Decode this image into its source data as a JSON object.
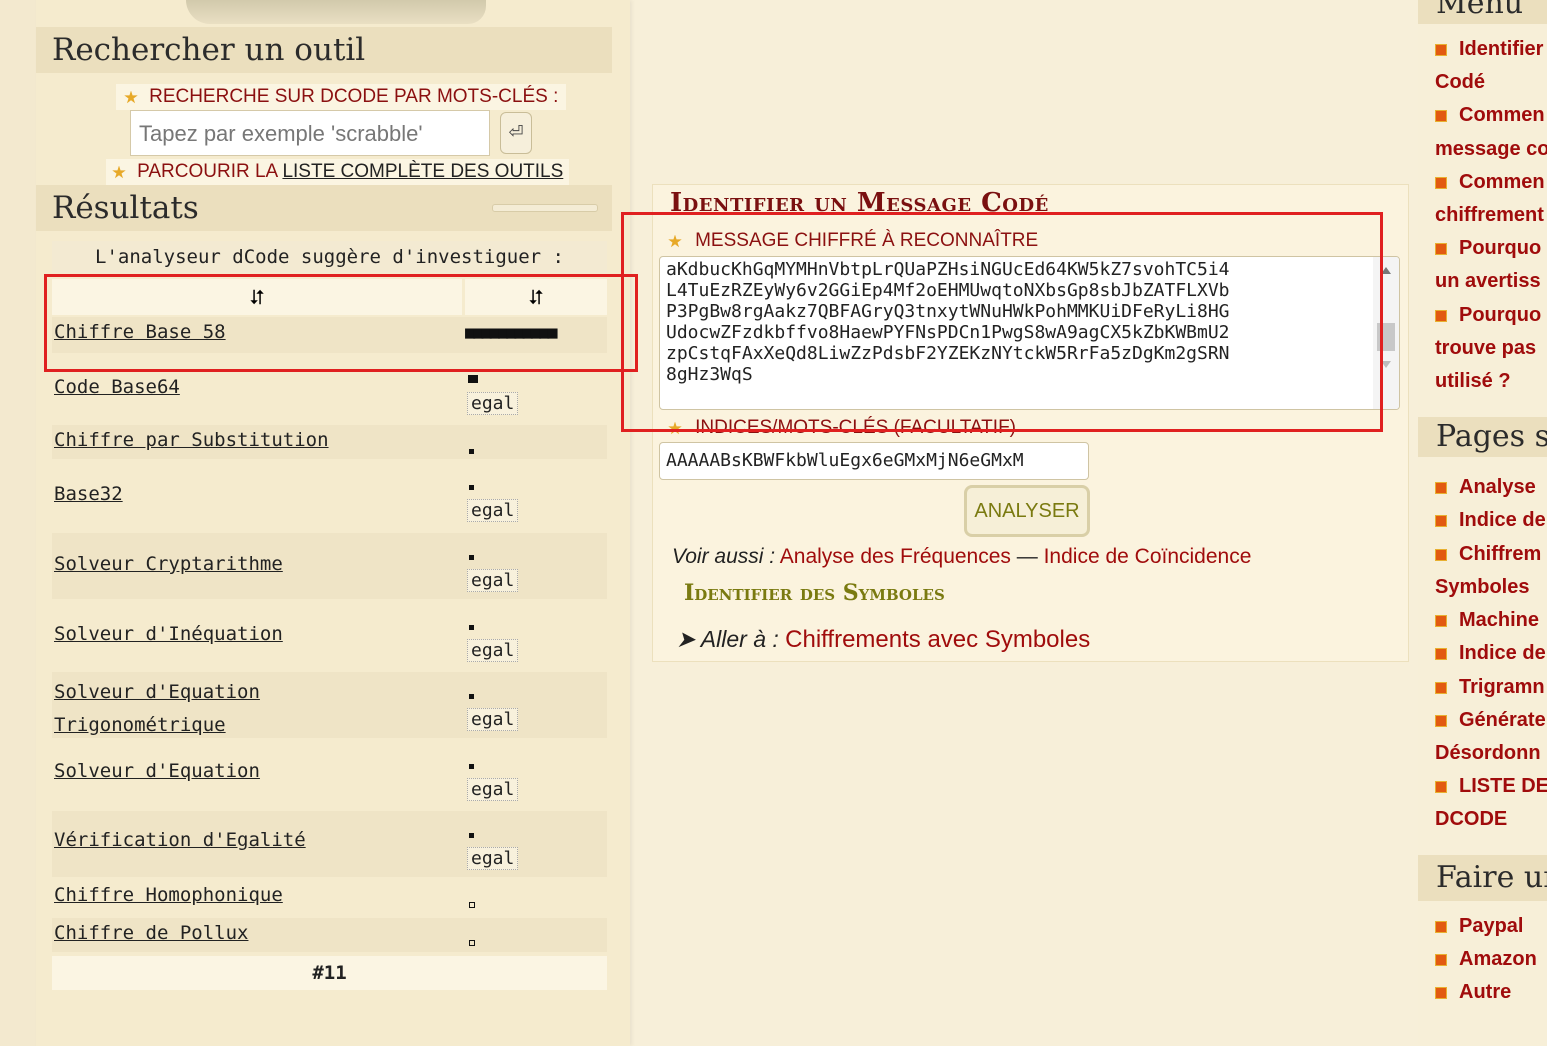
{
  "search": {
    "title": "Rechercher un outil",
    "keywords_label": "RECHERCHE SUR DCODE PAR MOTS-CLÉS :",
    "placeholder": "Tapez par exemple 'scrabble'",
    "submit_glyph": "⏎",
    "browse_prefix": "PARCOURIR LA ",
    "browse_link": "LISTE COMPLÈTE DES OUTILS"
  },
  "results": {
    "title": "Résultats",
    "header": "L'analyseur dCode suggère d'investiguer :",
    "sort_a": "⮃",
    "sort_b": "⮃",
    "rows": [
      {
        "name": "Chiffre Base 58",
        "score": "■■■■■■■■■■■",
        "tag": ""
      },
      {
        "name": "Code Base64",
        "score": "",
        "tag": "egal"
      },
      {
        "name": "Chiffre par Substitution",
        "score": "",
        "tag": ""
      },
      {
        "name": "Base32",
        "score": "",
        "tag": "egal"
      },
      {
        "name": "Solveur Cryptarithme",
        "score": "",
        "tag": "egal"
      },
      {
        "name": "Solveur d'Inéquation",
        "score": "",
        "tag": "egal"
      },
      {
        "name_line1": "Solveur d'Equation",
        "name_line2": "Trigonométrique",
        "tag": "egal"
      },
      {
        "name": "Solveur d'Equation",
        "score": "",
        "tag": "egal"
      },
      {
        "name": "Vérification d'Egalité",
        "score": "",
        "tag": "egal"
      },
      {
        "name": "Chiffre Homophonique",
        "score": "",
        "tag": ""
      },
      {
        "name": "Chiffre de Pollux",
        "score": "",
        "tag": ""
      }
    ],
    "footer": "#11"
  },
  "identify": {
    "title": "Identifier un Message Codé",
    "message_label": "MESSAGE CHIFFRÉ À RECONNAÎTRE",
    "message_text": "aKdbucKhGqMYMHnVbtpLrQUaPZHsiNGUcEd64KW5kZ7svohTC5i4\nL4TuEzRZEyWy6v2GGiEp4Mf2oEHMUwqtoNXbsGp8sbJbZATFLXVb\nP3PgBw8rgAakz7QBFAGryQ3tnxytWNuHWkPohMMKUiDFeRyLi8HG\nUdocwZFzdkbffvo8HaewPYFNsPDCn1PwgS8wA9agCX5kZbKWBmU2\nzpCstqFAxXeQd8LiwZzPdsbF2YZEKzNYtckW5RrFa5zDgKm2gSRN\n8gHz3WqS",
    "hints_label": "INDICES/MOTS-CLÉS (FACULTATIF)",
    "hints_value": "AAAAABsKBWFkbWluEgx6eGMxMjN6eGMxM",
    "analyse_button": "ANALYSER",
    "see_also_label": "Voir aussi :",
    "see_also_link1": "Analyse des Fréquences",
    "see_also_sep": " — ",
    "see_also_link2": "Indice de Coïncidence",
    "symbols_title": "Identifier des Symboles",
    "goto_label": "➤ Aller à :",
    "goto_link": "Chiffrements avec Symboles"
  },
  "right": {
    "menu_title": "Menu",
    "menu_items": [
      "Identifier",
      "Codé",
      "Commen",
      "message co",
      "Commen",
      "chiffrement",
      "Pourquo",
      "un avertiss",
      "Pourquo",
      "trouve pas",
      "utilisé ?"
    ],
    "pages_title": "Pages si",
    "pages_items": [
      "Analyse",
      "Indice de",
      "Chiffrem",
      "Symboles",
      "Machine",
      "Indice de",
      "Trigramn",
      "Générate",
      "Désordonn",
      "LISTE DE",
      "DCODE"
    ],
    "donate_title": "Faire un",
    "donate_items": [
      "Paypal",
      "Amazon",
      "Autre"
    ]
  }
}
